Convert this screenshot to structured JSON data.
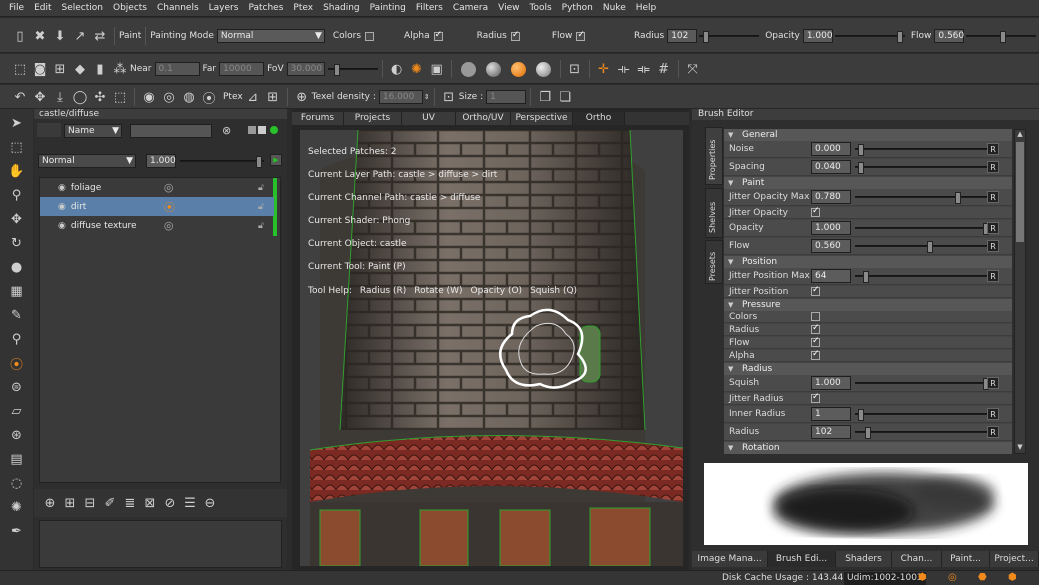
{
  "menu": [
    "File",
    "Edit",
    "Selection",
    "Objects",
    "Channels",
    "Layers",
    "Patches",
    "Ptex",
    "Shading",
    "Painting",
    "Filters",
    "Camera",
    "View",
    "Tools",
    "Python",
    "Nuke",
    "Help"
  ],
  "toolbar1": {
    "paint_label": "Paint",
    "painting_mode_label": "Painting Mode",
    "painting_mode_value": "Normal",
    "colors_label": "Colors",
    "alpha_label": "Alpha",
    "radius_label": "Radius",
    "flow_label": "Flow",
    "radius_field_label": "Radius",
    "radius_value": "102",
    "opacity_label": "Opacity",
    "opacity_value": "1.000",
    "flow_field_label": "Flow",
    "flow_value": "0.560"
  },
  "toolbar2": {
    "near_label": "Near",
    "near_value": "0.1",
    "far_label": "Far",
    "far_value": "10000",
    "fov_label": "FoV",
    "fov_value": "30.000"
  },
  "toolbar3": {
    "ptex_label": "Ptex",
    "texel_label": "Texel density :",
    "texel_value": "16.000",
    "size_label": "Size :",
    "size_value": "1"
  },
  "layers": {
    "path": "castle/diffuse",
    "filter_mode": "Name",
    "blend_mode": "Normal",
    "opacity": "1.000",
    "items": [
      {
        "name": "foliage"
      },
      {
        "name": "dirt"
      },
      {
        "name": "diffuse texture"
      }
    ]
  },
  "viewport": {
    "tabs": [
      "Forums",
      "Projects",
      "UV",
      "Ortho/UV",
      "Perspective",
      "Ortho"
    ],
    "active_tab": "Ortho",
    "info": [
      "Selected Patches: 2",
      "Current Layer Path: castle > diffuse > dirt",
      "Current Channel Path: castle > diffuse",
      "Current Shader: Phong",
      "Current Object: castle",
      "Current Tool: Paint (P)"
    ],
    "tool_help_label": "Tool Help:",
    "tool_help_items": [
      "Radius (R)",
      "Rotate (W)",
      "Opacity (O)",
      "Squish (Q)"
    ]
  },
  "brush_editor": {
    "title": "Brush Editor",
    "side_tabs": [
      "Properties",
      "Shelves",
      "Presets"
    ],
    "sections": {
      "general": "General",
      "paint": "Paint",
      "position": "Position",
      "pressure": "Pressure",
      "radius": "Radius",
      "rotation": "Rotation"
    },
    "general_rows": [
      {
        "name": "Noise",
        "value": "0.000"
      },
      {
        "name": "Spacing",
        "value": "0.040"
      }
    ],
    "paint_rows": [
      {
        "name": "Jitter Opacity Max",
        "value": "0.780"
      },
      {
        "name": "Jitter Opacity"
      },
      {
        "name": "Opacity",
        "value": "1.000"
      },
      {
        "name": "Flow",
        "value": "0.560"
      }
    ],
    "position_rows": [
      {
        "name": "Jitter Position Max",
        "value": "64"
      },
      {
        "name": "Jitter Position"
      }
    ],
    "pressure_rows": [
      {
        "name": "Colors"
      },
      {
        "name": "Radius"
      },
      {
        "name": "Flow"
      },
      {
        "name": "Alpha"
      }
    ],
    "radius_rows": [
      {
        "name": "Squish",
        "value": "1.000"
      },
      {
        "name": "Jitter Radius"
      },
      {
        "name": "Inner Radius",
        "value": "1"
      },
      {
        "name": "Radius",
        "value": "102"
      }
    ],
    "reset_label": "R"
  },
  "bottom_tabs": [
    "Image Mana...",
    "Brush Edi...",
    "Shaders",
    "Chan...",
    "Paint...",
    "Project..."
  ],
  "status": {
    "disk_cache": "Disk Cache Usage : 143.44MB",
    "udim": "Udim:1002-1003"
  },
  "colors": {
    "accent": "#f08a1c",
    "selection": "#5a7fa8",
    "green": "#27c22a"
  }
}
